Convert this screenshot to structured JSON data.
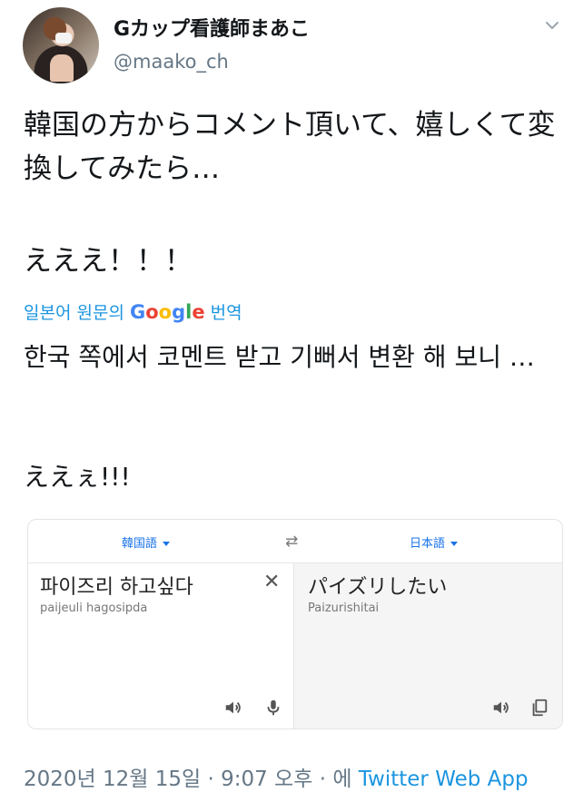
{
  "tweet": {
    "display_name": "Gカップ看護師まあこ",
    "handle": "@maako_ch",
    "text": "韓国の方からコメント頂いて、嬉しくて変換してみたら…",
    "exclaim": "えええ！！！",
    "translated_by_prefix": "일본어 원문의",
    "translated_by_google": "Google",
    "translated_by_suffix": "번역",
    "translation_text": "한국 쪽에서 코멘트 받고 기뻐서 변환 해 보니 …",
    "translation_exclaim": "ええぇ!!!",
    "timestamp": "2020년 12월 15일 · 9:07 오후 · 에",
    "client": "Twitter Web App"
  },
  "translate_card": {
    "source_lang": "韓国語",
    "target_lang": "日本語",
    "swap_symbol": "⇄",
    "source_text": "파이즈리 하고싶다",
    "source_romanization": "paijeuli hagosipda",
    "clear_symbol": "✕",
    "target_text": "パイズリしたい",
    "target_romanization": "Paizurishitai"
  },
  "colors": {
    "link": "#1b95e0",
    "google_blue": "#4285F4",
    "google_red": "#EA4335",
    "google_yellow": "#FBBC05",
    "google_green": "#34A853",
    "muted": "#657786"
  },
  "icons": [
    "chevron-down-icon",
    "swap-icon",
    "clear-icon",
    "speaker-icon",
    "microphone-icon",
    "copy-icon"
  ]
}
